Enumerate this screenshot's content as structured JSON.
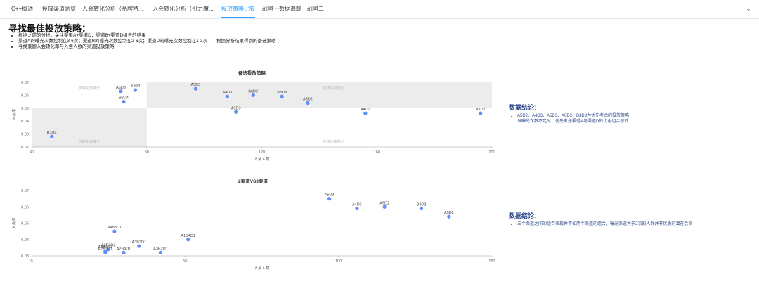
{
  "tabs": [
    {
      "label": "C++概述",
      "active": false
    },
    {
      "label": "投放渠道总览",
      "active": false
    },
    {
      "label": "入会转化分析（品牌特...",
      "active": false
    },
    {
      "label": "入会转化分析（引力魔...",
      "active": false
    },
    {
      "label": "投放策略比较",
      "active": true
    },
    {
      "label": "战略一数据追踪",
      "active": false
    },
    {
      "label": "战略二",
      "active": false
    }
  ],
  "page": {
    "title": "寻找最佳投放策略：",
    "bullets": [
      "根据之前的分析，关注渠道A+渠道D，渠道B+渠道D组合的结果",
      "渠道A的曝光次数控制在3-6次；渠道B的曝光次数控制在2-6次；渠道D的曝光次数控制在1-3次——根据分析结果得到的备选策略",
      "寻找兼顾入会转化率与入会人数的渠道投放策略"
    ]
  },
  "colors": {
    "accent": "#409eff",
    "point": "#5b8ff9",
    "quadrant": "#ececec",
    "conclusion": "#2f4a8a"
  },
  "chart_data": [
    {
      "type": "scatter",
      "title": "备选投放策略",
      "xlabel": "入会人数",
      "ylabel": "入会率",
      "xlim": [
        40,
        200
      ],
      "ylim": [
        0.02,
        0.07
      ],
      "xticks": [
        40,
        80,
        120,
        160,
        200
      ],
      "yticks": [
        0.02,
        0.03,
        0.04,
        0.05,
        0.06,
        0.07
      ],
      "quadrant_split": {
        "x": 80,
        "y": 0.05
      },
      "quadrant_labels": [
        "高转化高曝光",
        "高转化高曝光",
        "低转化高曝光",
        "低转化高曝光"
      ],
      "points": [
        {
          "label": "A6D3",
          "x": 71,
          "y": 0.063
        },
        {
          "label": "B4D4",
          "x": 76,
          "y": 0.064
        },
        {
          "label": "B3D4",
          "x": 72,
          "y": 0.055
        },
        {
          "label": "A5D3",
          "x": 97,
          "y": 0.065
        },
        {
          "label": "A4D3",
          "x": 108,
          "y": 0.059
        },
        {
          "label": "A6D2",
          "x": 117,
          "y": 0.06
        },
        {
          "label": "A3D3",
          "x": 111,
          "y": 0.047
        },
        {
          "label": "B3D3",
          "x": 127,
          "y": 0.059
        },
        {
          "label": "A5D2",
          "x": 136,
          "y": 0.054
        },
        {
          "label": "A4D2",
          "x": 156,
          "y": 0.046
        },
        {
          "label": "A3D2",
          "x": 196,
          "y": 0.046
        },
        {
          "label": "B2D4",
          "x": 47,
          "y": 0.028
        }
      ]
    },
    {
      "type": "scatter",
      "title": "2渠道VS3渠道",
      "xlabel": "入会人数",
      "ylabel": "入会率",
      "xlim": [
        0,
        150
      ],
      "ylim": [
        0.03,
        0.07
      ],
      "xticks": [
        0,
        50,
        100,
        150
      ],
      "yticks": [
        0.03,
        0.04,
        0.05,
        0.06,
        0.07
      ],
      "points": [
        {
          "label": "A5D3",
          "x": 97,
          "y": 0.065
        },
        {
          "label": "A4D3",
          "x": 106,
          "y": 0.059
        },
        {
          "label": "A6D2",
          "x": 115,
          "y": 0.06
        },
        {
          "label": "B3D3",
          "x": 127,
          "y": 0.059
        },
        {
          "label": "A5D2",
          "x": 136,
          "y": 0.054
        },
        {
          "label": "A4B3D1",
          "x": 27,
          "y": 0.045
        },
        {
          "label": "A1B4D1",
          "x": 51,
          "y": 0.04
        },
        {
          "label": "A3B3D1",
          "x": 35,
          "y": 0.036
        },
        {
          "label": "A3B2D1",
          "x": 42,
          "y": 0.032
        },
        {
          "label": "A3B2D2",
          "x": 24,
          "y": 0.033
        },
        {
          "label": "A2B2D2",
          "x": 25,
          "y": 0.034
        },
        {
          "label": "A2B3D1",
          "x": 24,
          "y": 0.032
        },
        {
          "label": "A2B4D1",
          "x": 30,
          "y": 0.032
        }
      ]
    }
  ],
  "conclusions": [
    {
      "title": "数据结论：",
      "items": [
        "A5D2、A4D3、A5D3、A6D2、B3D3为优先考虑的投放策略",
        "当曝光次数不足时，优先考虑渠道A与渠道D的优化组合形式"
      ]
    },
    {
      "title": "数据结论：",
      "items": [
        "三个渠道之间的组合表现并不如两个渠道的组合，曝光渠道大于2次的人群并非优质的潜在会员"
      ]
    }
  ]
}
